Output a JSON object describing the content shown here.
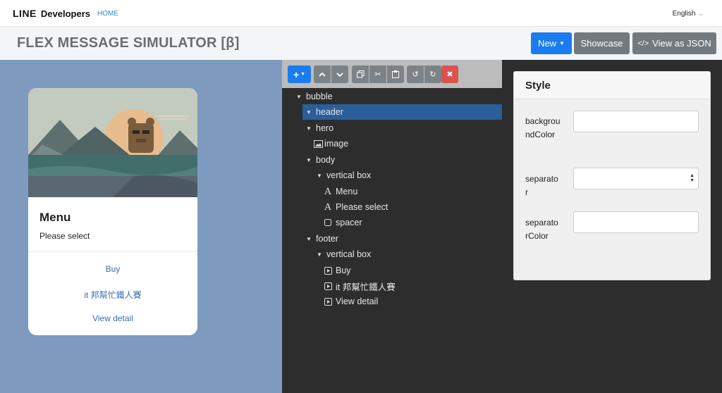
{
  "nav": {
    "brand_line": "LINE",
    "brand_dev": "Developers",
    "home": "HOME",
    "language": "English"
  },
  "title_bar": {
    "title": "FLEX MESSAGE SIMULATOR [β]",
    "buttons": {
      "new": "New",
      "showcase": "Showcase",
      "view_json": "View as JSON"
    }
  },
  "preview": {
    "hero_icon": "image",
    "title": "Menu",
    "subtitle": "Please select",
    "buttons": [
      "Buy",
      "it 邦幫忙鐵人賽",
      "View detail"
    ]
  },
  "toolbar": {
    "icons": [
      "plus-icon",
      "move-up-icon",
      "move-down-icon",
      "copy-icon",
      "cut-icon",
      "paste-icon",
      "undo-icon",
      "redo-icon",
      "delete-icon"
    ]
  },
  "tree": [
    {
      "label": "bubble",
      "icon": "caret-down",
      "level": 0
    },
    {
      "label": "header",
      "icon": "caret-down",
      "level": 1,
      "selected": true
    },
    {
      "label": "hero",
      "icon": "caret-down",
      "level": 1
    },
    {
      "label": "image",
      "icon": "image-icon",
      "level": 2
    },
    {
      "label": "body",
      "icon": "caret-down",
      "level": 1
    },
    {
      "label": "vertical box",
      "icon": "caret-down",
      "level": 2
    },
    {
      "label": "Menu",
      "icon": "text-icon",
      "level": 3
    },
    {
      "label": "Please select",
      "icon": "text-icon",
      "level": 3
    },
    {
      "label": "spacer",
      "icon": "spacer-icon",
      "level": 3
    },
    {
      "label": "footer",
      "icon": "caret-down",
      "level": 1
    },
    {
      "label": "vertical box",
      "icon": "caret-down",
      "level": 2
    },
    {
      "label": "Buy",
      "icon": "button-icon",
      "level": 3
    },
    {
      "label": "it 邦幫忙鐵人賽",
      "icon": "button-icon",
      "level": 3
    },
    {
      "label": "View detail",
      "icon": "button-icon",
      "level": 3
    }
  ],
  "style_panel": {
    "title": "Style",
    "props": [
      {
        "label": "backgroundColor",
        "value": ""
      },
      {
        "label": "separator",
        "value": ""
      },
      {
        "label": "separatorColor",
        "value": ""
      }
    ]
  },
  "colors": {
    "accent": "#1a7cf0",
    "preview_bg": "#7e9bbf",
    "tree_bg": "#2d2d2d",
    "selected": "#2b5e9b",
    "delete": "#d9534f"
  }
}
